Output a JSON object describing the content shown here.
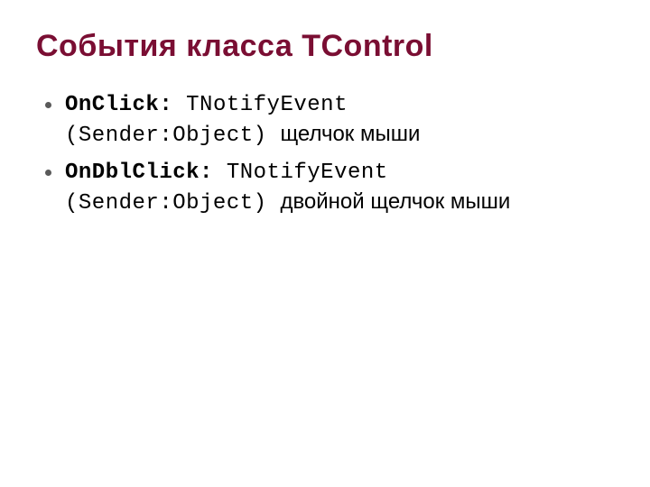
{
  "title": "События класса TControl",
  "items": [
    {
      "name": "OnClick",
      "colon": ": ",
      "type": "TNotifyEvent",
      "signature": "(Sender:Object) ",
      "description": "щелчок мыши"
    },
    {
      "name": "OnDblClick",
      "colon": ": ",
      "type": "TNotifyEvent",
      "signature": "(Sender:Object) ",
      "description": "двойной щелчок мыши"
    }
  ]
}
